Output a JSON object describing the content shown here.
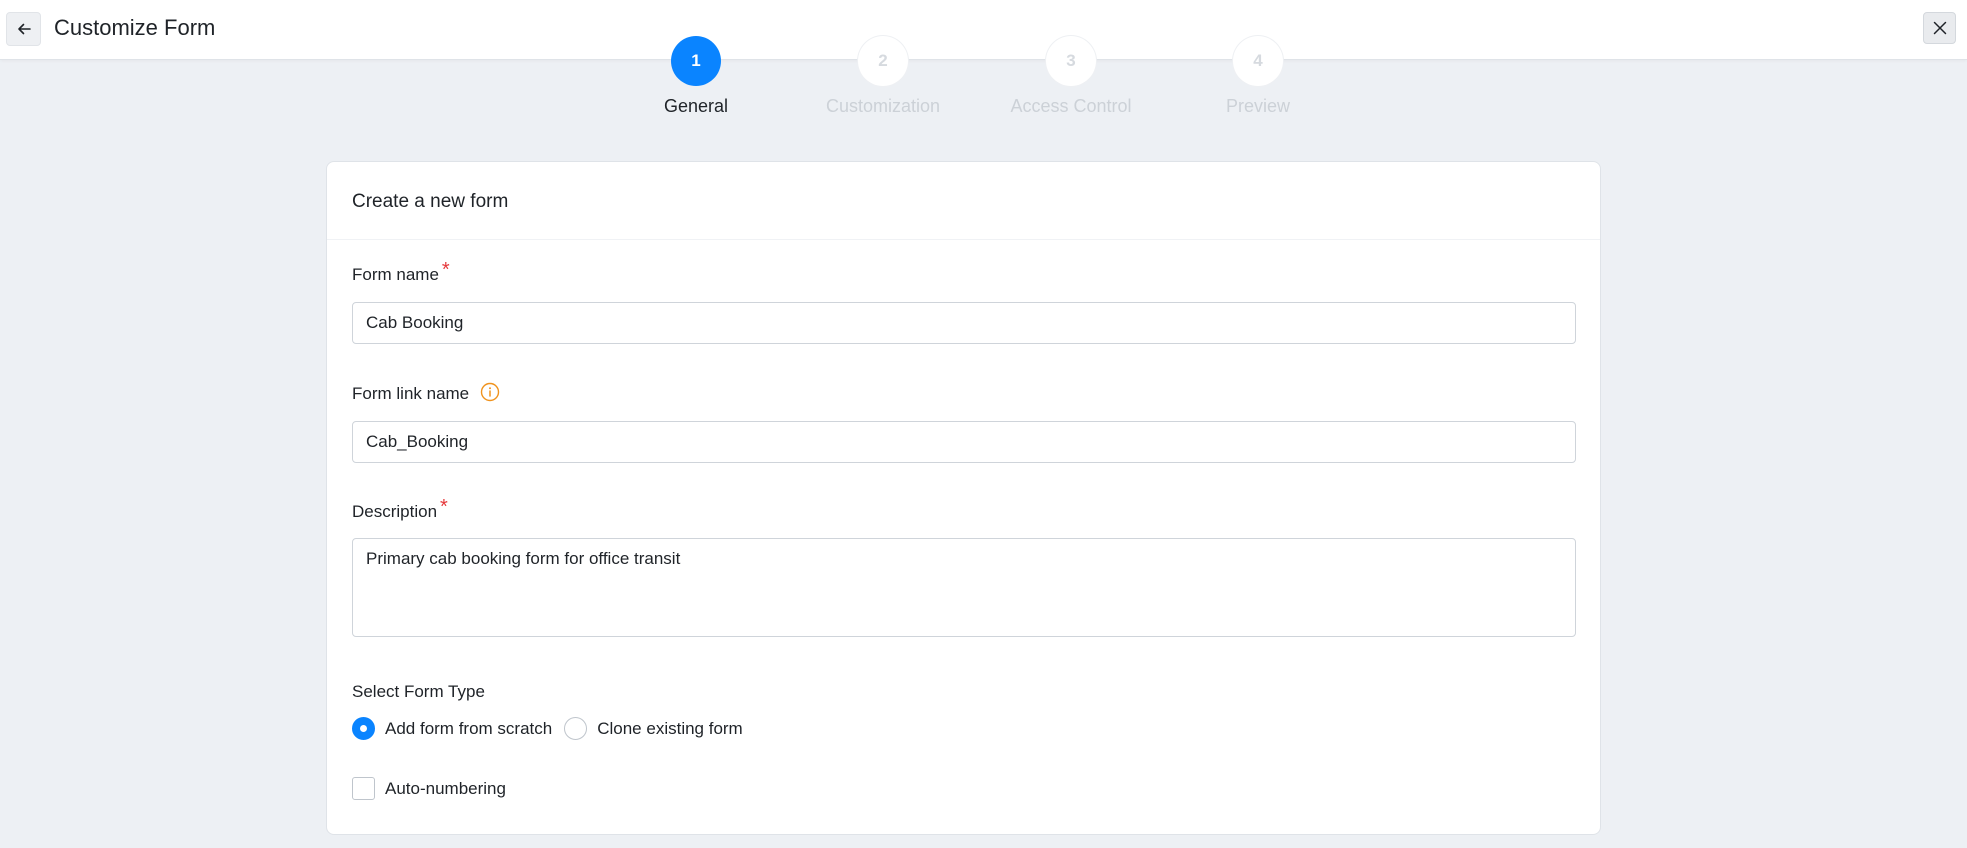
{
  "header": {
    "title": "Customize Form",
    "back_icon": "arrow-left-icon",
    "close_icon": "close-icon"
  },
  "stepper": {
    "accent_color": "#0a84ff",
    "steps": [
      {
        "number": "1",
        "label": "General",
        "state": "active"
      },
      {
        "number": "2",
        "label": "Customization",
        "state": "inactive"
      },
      {
        "number": "3",
        "label": "Access Control",
        "state": "inactive"
      },
      {
        "number": "4",
        "label": "Preview",
        "state": "inactive"
      }
    ]
  },
  "form": {
    "heading": "Create a new form",
    "form_name": {
      "label": "Form name",
      "required_mark": "*",
      "value": "Cab Booking"
    },
    "form_link_name": {
      "label": "Form link name",
      "info_icon": "info-icon",
      "value": "Cab_Booking"
    },
    "description": {
      "label": "Description",
      "required_mark": "*",
      "value": "Primary cab booking form for office transit"
    },
    "form_type": {
      "label": "Select Form Type",
      "options": [
        {
          "label": "Add form from scratch",
          "selected": true
        },
        {
          "label": "Clone existing form",
          "selected": false
        }
      ]
    },
    "auto_numbering": {
      "label": "Auto-numbering",
      "checked": false
    }
  }
}
